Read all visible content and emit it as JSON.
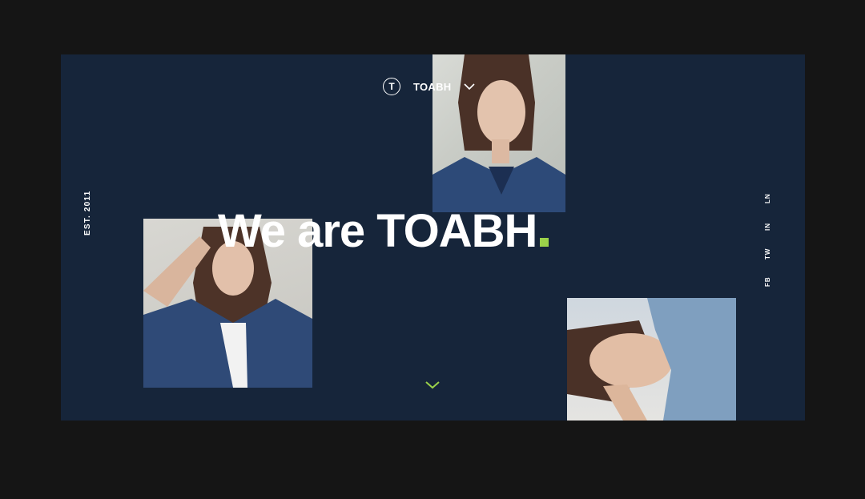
{
  "brand": {
    "logo_letter": "T",
    "name": "TOABH"
  },
  "hero": {
    "headline": "We are TOABH",
    "established": "EST. 2011"
  },
  "socials": {
    "fb": "FB",
    "tw": "TW",
    "in": "IN",
    "ln": "LN"
  },
  "colors": {
    "page_background": "#151515",
    "hero_background": "#16253a",
    "accent": "#9bd24a",
    "text": "#ffffff"
  },
  "icons": {
    "menu_toggle": "chevron-down-icon",
    "scroll_down": "chevron-down-icon"
  }
}
